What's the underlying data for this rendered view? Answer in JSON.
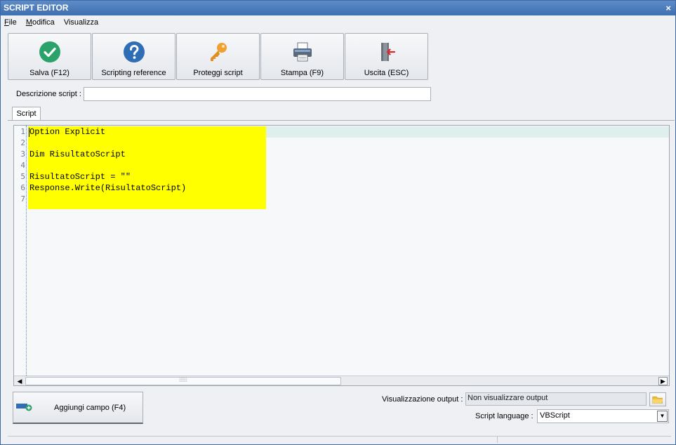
{
  "window": {
    "title": "SCRIPT EDITOR",
    "close_glyph": "×"
  },
  "menu": [
    {
      "label": "File",
      "mnemonic": "F",
      "rest": "ile"
    },
    {
      "label": "Modifica",
      "mnemonic": "M",
      "rest": "odifica"
    },
    {
      "label": "Visualizza",
      "mnemonic": "",
      "rest": "Visualizza"
    }
  ],
  "toolbar": {
    "save": {
      "label": "Salva (F12)",
      "icon": "check-circle-icon"
    },
    "reference": {
      "label": "Scripting reference",
      "icon": "help-circle-icon"
    },
    "protect": {
      "label": "Proteggi script",
      "icon": "key-icon"
    },
    "print": {
      "label": "Stampa (F9)",
      "icon": "printer-icon"
    },
    "exit": {
      "label": "Uscita (ESC)",
      "icon": "exit-door-icon"
    }
  },
  "description": {
    "label": "Descrizione script :",
    "value": ""
  },
  "tabs": [
    {
      "label": "Script"
    }
  ],
  "editor": {
    "lines": [
      {
        "n": "1",
        "text": "Option Explicit"
      },
      {
        "n": "2",
        "text": ""
      },
      {
        "n": "3",
        "text": "Dim RisultatoScript"
      },
      {
        "n": "4",
        "text": ""
      },
      {
        "n": "5",
        "text": "RisultatoScript = \"\""
      },
      {
        "n": "6",
        "text": "Response.Write(RisultatoScript)"
      },
      {
        "n": "7",
        "text": ""
      }
    ],
    "highlight_color": "#ffff00",
    "current_line_color": "#dff0ec"
  },
  "add_field": {
    "label": "Aggiungi campo (F4)"
  },
  "output": {
    "label": "Visualizzazione output :",
    "value": "Non visualizzare output"
  },
  "language": {
    "label": "Script language :",
    "value": "VBScript"
  },
  "colors": {
    "titlebar": "#3e6fb0",
    "check": "#2aa36b",
    "help": "#2f6db5",
    "key": "#f0a030",
    "exit_arrow": "#d62b2b"
  }
}
